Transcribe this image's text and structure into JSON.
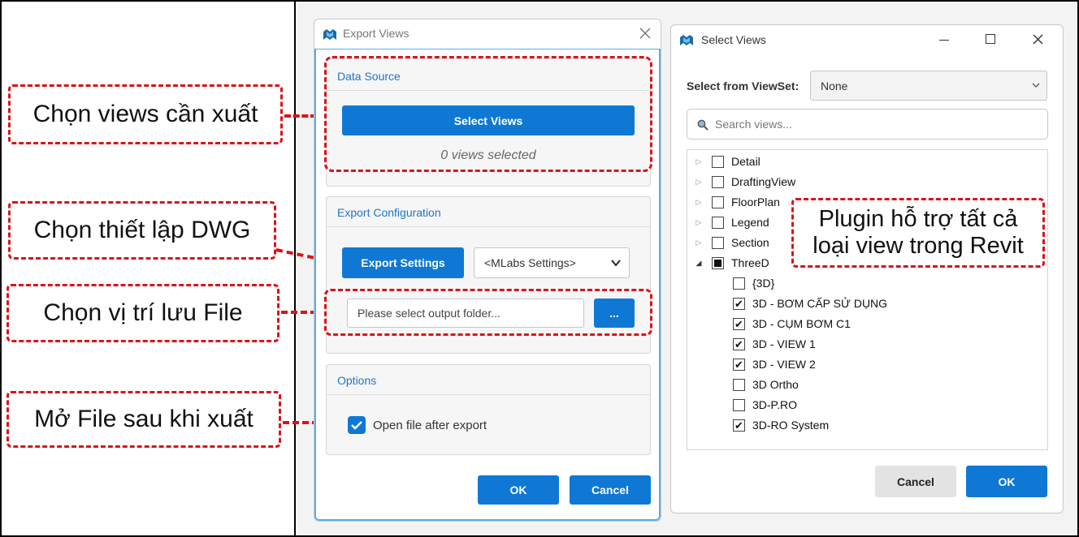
{
  "callouts": {
    "select_views": "Chọn views cần xuất",
    "dwg_settings": "Chọn thiết lập DWG",
    "save_location": "Chọn vị trí lưu File",
    "open_after": "Mở File sau khi xuất",
    "plugin_support": [
      "Plugin hỗ trợ tất cả",
      "loại view trong Revit"
    ]
  },
  "export_window": {
    "title": "Export Views",
    "data_source": {
      "header": "Data Source",
      "select_button": "Select Views",
      "status": "0 views selected"
    },
    "export_config": {
      "header": "Export Configuration",
      "settings_button": "Export Settings",
      "settings_select": "<MLabs Settings>",
      "folder_placeholder": "Please select output folder...",
      "browse_button": "..."
    },
    "options": {
      "header": "Options",
      "open_after_label": "Open file after export",
      "open_after_checked": true
    },
    "ok": "OK",
    "cancel": "Cancel"
  },
  "select_window": {
    "title": "Select Views",
    "viewset_label": "Select from ViewSet:",
    "viewset_value": "None",
    "search_placeholder": "Search views...",
    "tree": [
      {
        "label": "Detail",
        "expand": "collapsed",
        "state": "unchecked",
        "level": 0
      },
      {
        "label": "DraftingView",
        "expand": "collapsed",
        "state": "unchecked",
        "level": 0
      },
      {
        "label": "FloorPlan",
        "expand": "collapsed",
        "state": "unchecked",
        "level": 0
      },
      {
        "label": "Legend",
        "expand": "collapsed",
        "state": "unchecked",
        "level": 0
      },
      {
        "label": "Section",
        "expand": "collapsed",
        "state": "unchecked",
        "level": 0
      },
      {
        "label": "ThreeD",
        "expand": "expanded",
        "state": "partial",
        "level": 0
      },
      {
        "label": "{3D}",
        "expand": "none",
        "state": "unchecked",
        "level": 1
      },
      {
        "label": "3D - BƠM CẤP SỬ DỤNG",
        "expand": "none",
        "state": "checked",
        "level": 1
      },
      {
        "label": "3D - CỤM BƠM C1",
        "expand": "none",
        "state": "checked",
        "level": 1
      },
      {
        "label": "3D - VIEW 1",
        "expand": "none",
        "state": "checked",
        "level": 1
      },
      {
        "label": "3D - VIEW 2",
        "expand": "none",
        "state": "checked",
        "level": 1
      },
      {
        "label": "3D Ortho",
        "expand": "none",
        "state": "unchecked",
        "level": 1
      },
      {
        "label": "3D-P.RO",
        "expand": "none",
        "state": "unchecked",
        "level": 1
      },
      {
        "label": "3D-RO System",
        "expand": "none",
        "state": "checked",
        "level": 1
      }
    ],
    "cancel": "Cancel",
    "ok": "OK"
  },
  "colors": {
    "accent": "#0f78d4",
    "callout_border": "#d9141a",
    "group_header": "#1f74c9"
  }
}
